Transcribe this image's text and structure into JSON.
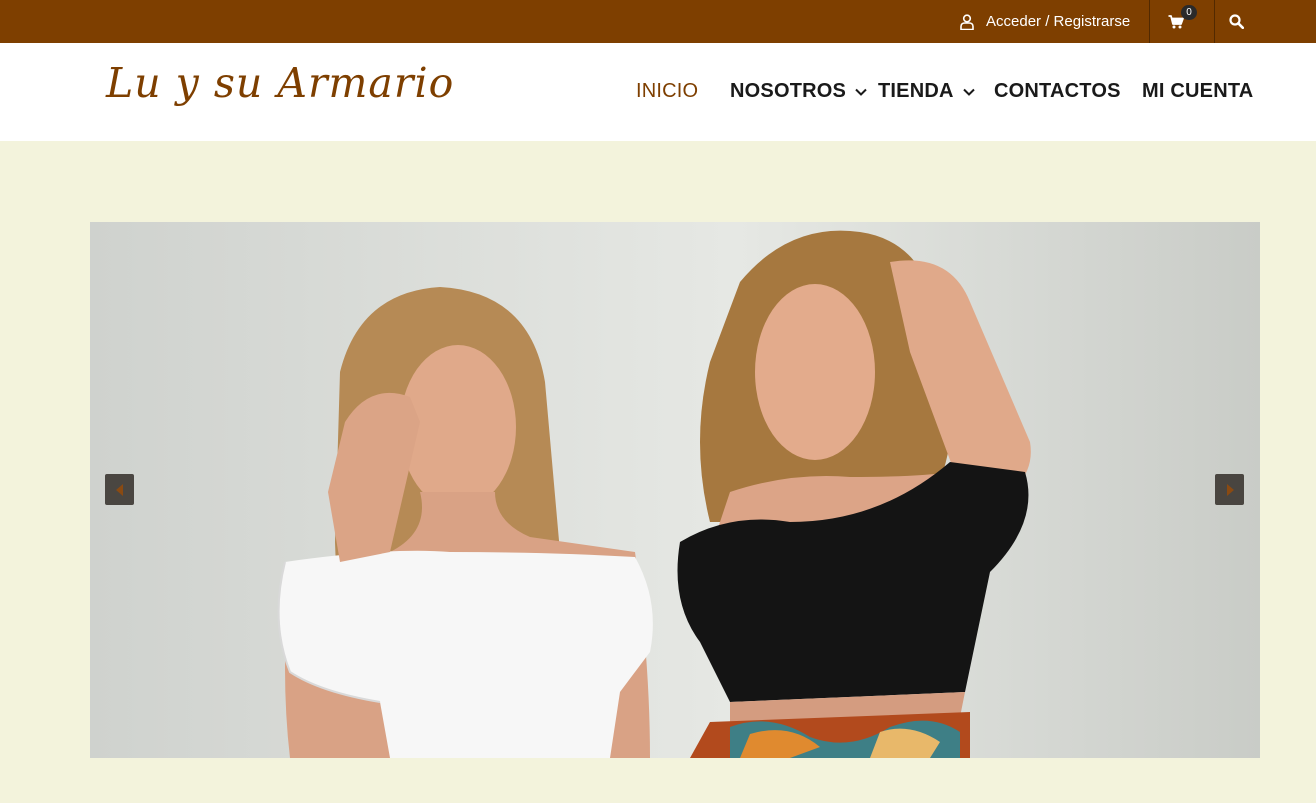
{
  "topbar": {
    "login_label": "Acceder / Registrarse",
    "cart_count": "0"
  },
  "header": {
    "logo_text": "Lu y su Armario"
  },
  "nav": {
    "items": [
      {
        "label": "INICIO",
        "active": true,
        "has_dropdown": false
      },
      {
        "label": "NOSOTROS",
        "active": false,
        "has_dropdown": true
      },
      {
        "label": "TIENDA",
        "active": false,
        "has_dropdown": true
      },
      {
        "label": "CONTACTOS",
        "active": false,
        "has_dropdown": false
      },
      {
        "label": "MI CUENTA",
        "active": false,
        "has_dropdown": false
      }
    ]
  },
  "colors": {
    "brand": "#7e3f00",
    "page_background": "#f3f3dc",
    "header_background": "#ffffff",
    "nav_text": "#1a1a1a"
  },
  "icons": [
    "user-icon",
    "cart-icon",
    "search-icon",
    "chevron-down-icon",
    "arrow-left-icon",
    "arrow-right-icon"
  ]
}
